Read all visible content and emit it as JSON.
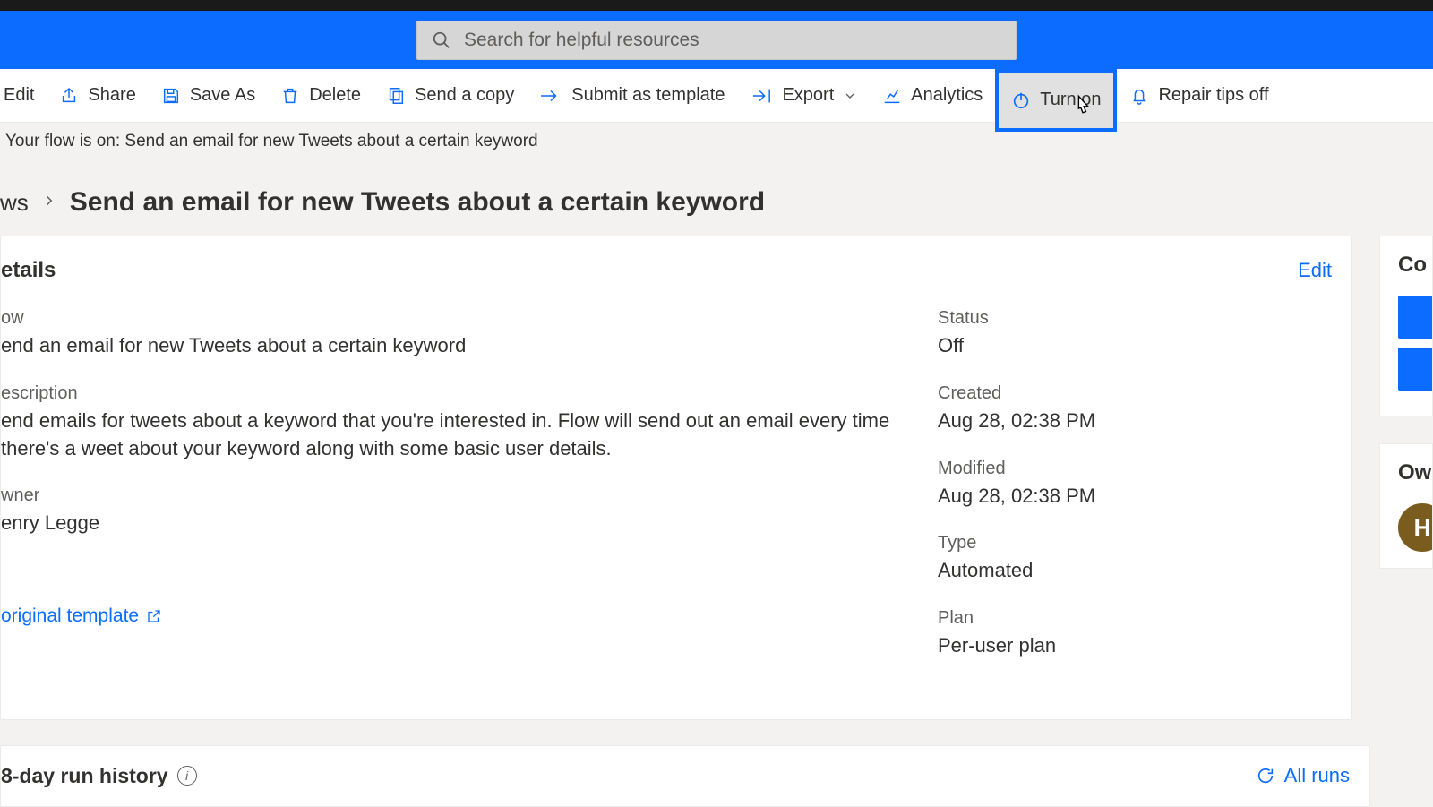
{
  "search": {
    "placeholder": "Search for helpful resources"
  },
  "toolbar": {
    "edit": "Edit",
    "share": "Share",
    "save_as": "Save As",
    "delete": "Delete",
    "send_copy": "Send a copy",
    "submit_template": "Submit as template",
    "export": "Export",
    "analytics": "Analytics",
    "turn_on": "Turn on",
    "repair_tips": "Repair tips off"
  },
  "status_line": "Your flow is on: Send an email for new Tweets about a certain keyword",
  "breadcrumb": {
    "root": "ws",
    "title": "Send an email for new Tweets about a certain keyword"
  },
  "details": {
    "heading": "etails",
    "edit": "Edit",
    "flow_label": "ow",
    "flow_value": "end an email for new Tweets about a certain keyword",
    "desc_label": "escription",
    "desc_value": "end emails for tweets about a keyword that you're interested in. Flow will send out an email every time there's a weet about your keyword along with some basic user details.",
    "owner_label": "wner",
    "owner_value": "enry Legge",
    "status_label": "Status",
    "status_value": "Off",
    "created_label": "Created",
    "created_value": "Aug 28, 02:38 PM",
    "modified_label": "Modified",
    "modified_value": "Aug 28, 02:38 PM",
    "type_label": "Type",
    "type_value": "Automated",
    "plan_label": "Plan",
    "plan_value": "Per-user plan",
    "original_template": "original template"
  },
  "side": {
    "connections": "Co",
    "owners": "Ow",
    "avatar_initial": "H"
  },
  "history": {
    "title": "8-day run history",
    "all_runs": "All runs"
  }
}
